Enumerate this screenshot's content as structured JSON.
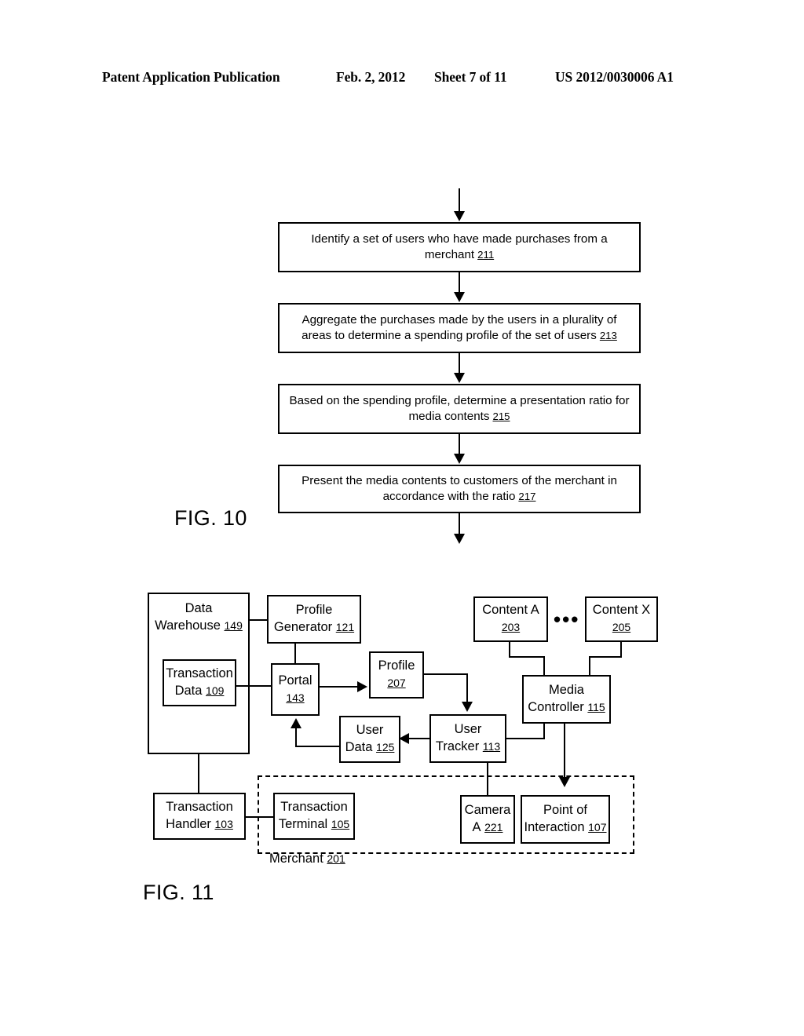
{
  "header": {
    "publication": "Patent Application Publication",
    "date": "Feb. 2, 2012",
    "sheet": "Sheet 7 of 11",
    "document_number": "US 2012/0030006 A1"
  },
  "figures": [
    {
      "id": "fig-10",
      "label": "FIG. 10",
      "type": "flowchart",
      "steps": [
        {
          "text": "Identify a set of users who have made purchases from a merchant",
          "ref": "211"
        },
        {
          "text": "Aggregate the purchases made by the users in a plurality of areas to determine a spending profile of the set of users",
          "ref": "213"
        },
        {
          "text": "Based on the spending profile, determine a presentation ratio for media contents",
          "ref": "215"
        },
        {
          "text": "Present the media contents to customers of the merchant in accordance with the ratio",
          "ref": "217"
        }
      ]
    },
    {
      "id": "fig-11",
      "label": "FIG. 11",
      "type": "block-diagram",
      "blocks": [
        {
          "key": "data_warehouse",
          "text": "Data Warehouse",
          "ref": "149"
        },
        {
          "key": "transaction_data",
          "text": "Transaction Data",
          "ref": "109"
        },
        {
          "key": "profile_generator",
          "text": "Profile Generator",
          "ref": "121"
        },
        {
          "key": "portal",
          "text": "Portal",
          "ref": "143"
        },
        {
          "key": "profile",
          "text": "Profile",
          "ref": "207"
        },
        {
          "key": "content_a",
          "text": "Content A",
          "ref": "203"
        },
        {
          "key": "content_x",
          "text": "Content X",
          "ref": "205"
        },
        {
          "key": "media_controller",
          "text": "Media Controller",
          "ref": "115"
        },
        {
          "key": "user_data",
          "text": "User Data",
          "ref": "125"
        },
        {
          "key": "user_tracker",
          "text": "User Tracker",
          "ref": "113"
        },
        {
          "key": "transaction_handler",
          "text": "Transaction Handler",
          "ref": "103"
        },
        {
          "key": "transaction_terminal",
          "text": "Transaction Terminal",
          "ref": "105"
        },
        {
          "key": "camera_a",
          "text": "Camera A",
          "ref": "221"
        },
        {
          "key": "point_of_interaction",
          "text": "Point of Interaction",
          "ref": "107"
        }
      ],
      "group": {
        "key": "merchant",
        "text": "Merchant",
        "ref": "201"
      },
      "ellipsis": "•••"
    }
  ]
}
